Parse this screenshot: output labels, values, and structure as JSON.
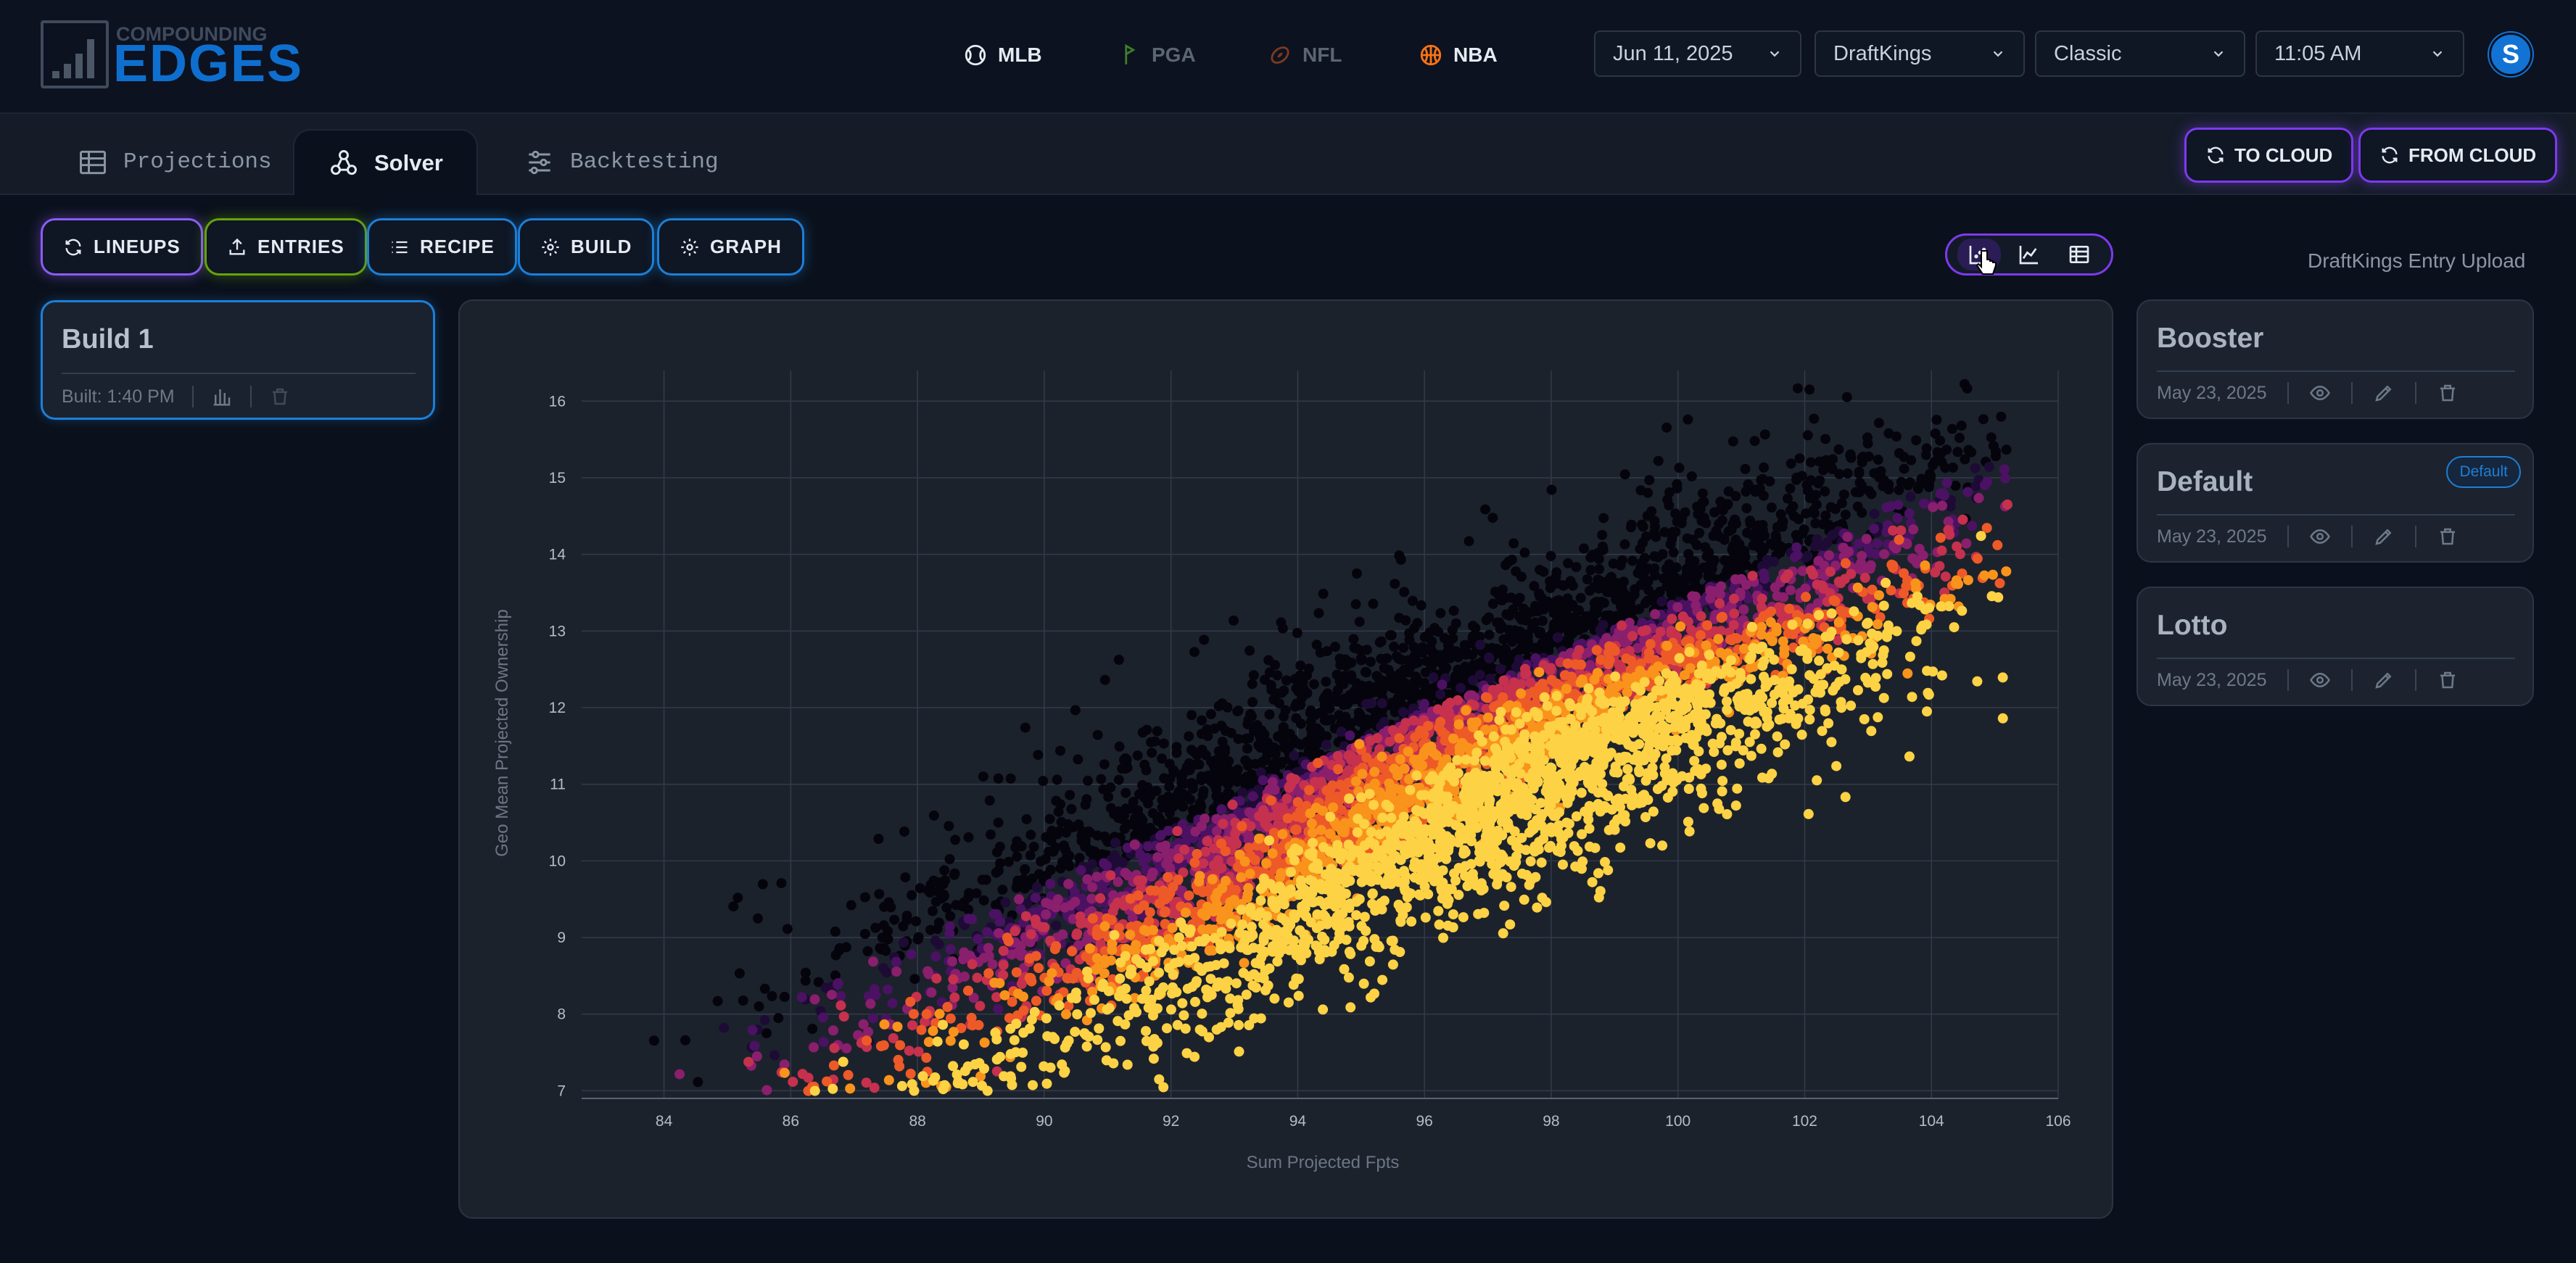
{
  "brand": {
    "line1": "COMPOUNDING",
    "line2": "EDGES"
  },
  "sports": [
    {
      "label": "MLB",
      "color": "#e6ebf2"
    },
    {
      "label": "PGA",
      "color": "#5b6574"
    },
    {
      "label": "NFL",
      "color": "#5b6574"
    },
    {
      "label": "NBA",
      "color": "#e6ebf2"
    }
  ],
  "filters": {
    "date": "Jun 11, 2025",
    "site": "DraftKings",
    "type": "Classic",
    "time": "11:05 AM"
  },
  "user": {
    "initial": "S"
  },
  "tabs": [
    {
      "label": "Projections"
    },
    {
      "label": "Solver"
    },
    {
      "label": "Backtesting"
    }
  ],
  "cloud": {
    "to": "TO CLOUD",
    "from": "FROM CLOUD"
  },
  "actions": {
    "lineups": "LINEUPS",
    "entries": "ENTRIES",
    "recipe": "RECIPE",
    "build": "BUILD",
    "graph": "GRAPH"
  },
  "upload_label": "DraftKings Entry Upload",
  "build": {
    "title": "Build 1",
    "built": "Built: 1:40 PM"
  },
  "recipes": [
    {
      "title": "Booster",
      "date": "May 23, 2025",
      "badge": ""
    },
    {
      "title": "Default",
      "date": "May 23, 2025",
      "badge": "Default"
    },
    {
      "title": "Lotto",
      "date": "May 23, 2025",
      "badge": ""
    }
  ],
  "chart_data": {
    "type": "scatter",
    "xlabel": "Sum Projected Fpts",
    "ylabel": "Geo Mean Projected Ownership",
    "xlim": [
      82.7,
      106
    ],
    "ylim": [
      6.9,
      16.4
    ],
    "xticks": [
      84,
      86,
      88,
      90,
      92,
      94,
      96,
      98,
      100,
      102,
      104,
      106
    ],
    "yticks": [
      7,
      8,
      9,
      10,
      11,
      12,
      13,
      14,
      15,
      16
    ],
    "grid": true,
    "legend": "none",
    "color_scale": [
      "#05040c",
      "#1d0b35",
      "#4b1163",
      "#8a1f6d",
      "#c6314e",
      "#ee5a27",
      "#f9931c",
      "#fdd245"
    ],
    "point_count": 7000,
    "trend": {
      "slope": 0.37,
      "intercept": -24.3,
      "spread_y": 0.95
    },
    "x_distribution": {
      "mean": 96.2,
      "sd": 4.3,
      "min": 83.5,
      "max": 105.2
    },
    "hot_center": {
      "x": 98,
      "y": 11.6
    }
  }
}
